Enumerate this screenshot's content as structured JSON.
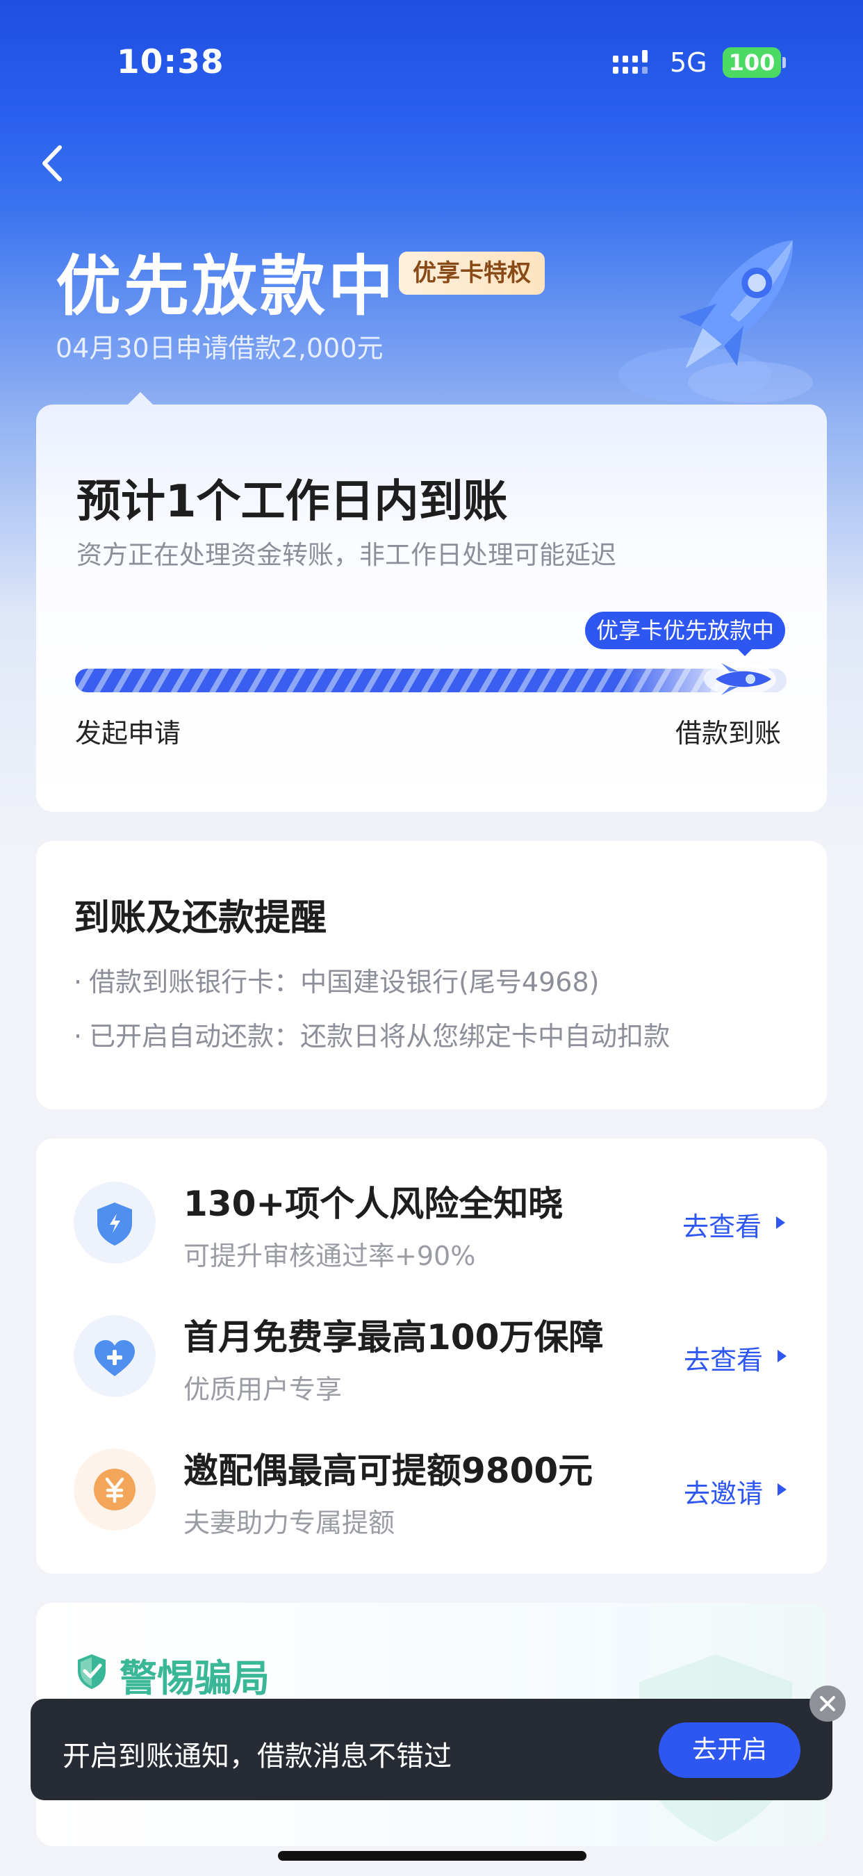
{
  "status_bar": {
    "time": "10:38",
    "network": "5G",
    "battery": "100"
  },
  "header": {
    "title": "优先放款中",
    "badge": "优享卡特权",
    "subtitle": "04月30日申请借款2,000元"
  },
  "progress_card": {
    "title": "预计1个工作日内到账",
    "subtitle": "资方正在处理资金转账，非工作日处理可能延迟",
    "bubble": "优享卡优先放款中",
    "progress_fraction": 0.92,
    "start_label": "发起申请",
    "end_label": "借款到账"
  },
  "reminder_card": {
    "title": "到账及还款提醒",
    "bullet": "·",
    "lines": [
      "借款到账银行卡：中国建设银行(尾号4968)",
      "已开启自动还款：还款日将从您绑定卡中自动扣款"
    ]
  },
  "services": [
    {
      "title": "130+项个人风险全知晓",
      "subtitle": "可提升审核通过率+90%",
      "action": "去查看",
      "icon": "shield-lightning-icon",
      "icon_bg": "#eef3fb",
      "icon_color": "#4f8ff0"
    },
    {
      "title": "首月免费享最高100万保障",
      "subtitle": "优质用户专享",
      "action": "去查看",
      "icon": "heart-plus-icon",
      "icon_bg": "#eef3fb",
      "icon_color": "#4f8ff0"
    },
    {
      "title": "邀配偶最高可提额9800元",
      "subtitle": "夫妻助力专属提额",
      "action": "去邀请",
      "icon": "yuan-coin-icon",
      "icon_bg": "#fdf3ea",
      "icon_color": "#f3a55a"
    }
  ],
  "fraud_card": {
    "title": "警惕骗局"
  },
  "toast": {
    "text": "开启到账通知，借款消息不错过",
    "button": "去开启"
  },
  "colors": {
    "primary": "#2e56f0",
    "accent_green": "#39b796",
    "badge_text": "#8a4a17"
  }
}
